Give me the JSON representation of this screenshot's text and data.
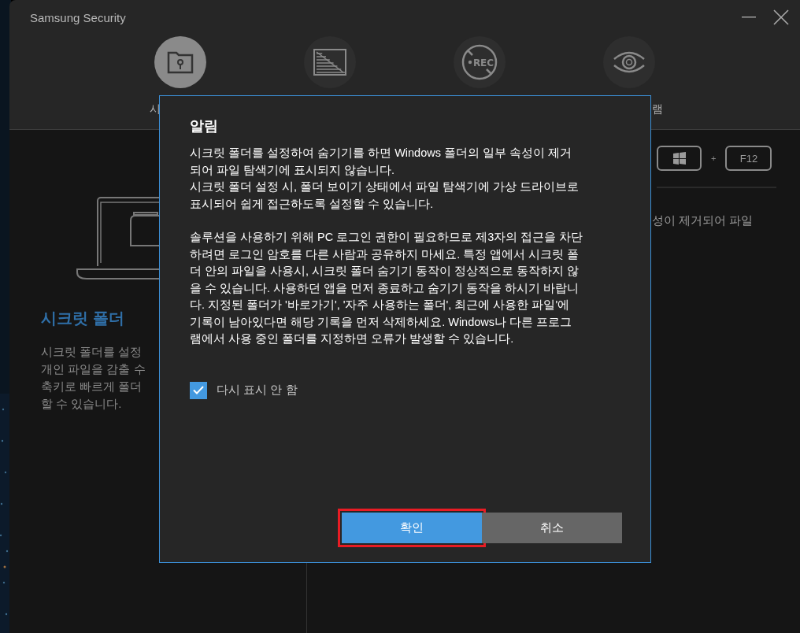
{
  "window": {
    "title": "Samsung Security"
  },
  "tabs": [
    {
      "label": "시",
      "selected": true
    },
    {
      "selected": false
    },
    {
      "selected": false,
      "icon_text": "REC"
    },
    {
      "label": "램",
      "selected": false
    }
  ],
  "left_panel": {
    "title": "시크릿 폴더",
    "description_lines": [
      "시크릿 폴더를 설정",
      "개인 파일을 감출 수",
      "축키로 빠르게 폴더",
      "할 수 있습니다."
    ]
  },
  "right_panel": {
    "keys": [
      {
        "kind": "windows"
      },
      {
        "kind": "text",
        "label": "F12"
      }
    ],
    "separator": "+",
    "text": "성이 제거되어 파일"
  },
  "dialog": {
    "title": "알림",
    "paragraphs": [
      {
        "lines": [
          "시크릿 폴더를 설정하여 숨기기를 하면 Windows 폴더의 일부 속성이 제거",
          "되어 파일 탐색기에 표시되지 않습니다.",
          "시크릿 폴더 설정 시, 폴더 보이기 상태에서 파일 탐색기에 가상 드라이브로",
          "표시되어 쉽게 접근하도록 설정할 수 있습니다."
        ]
      },
      {
        "lines": [
          "솔루션을 사용하기 위해 PC 로그인 권한이 필요하므로 제3자의 접근을 차단",
          "하려면 로그인 암호를 다른 사람과 공유하지 마세요. 특정 앱에서 시크릿 폴",
          "더 안의 파일을 사용시, 시크릿 폴더 숨기기 동작이 정상적으로 동작하지 않",
          "을 수 있습니다. 사용하던 앱을 먼저 종료하고 숨기기 동작을 하시기 바랍니",
          "다. 지정된 폴더가 '바로가기', '자주 사용하는 폴더', 최근에 사용한 파일'에",
          "기록이 남아있다면 해당 기록을 먼저 삭제하세요. Windows나 다른 프로그",
          "램에서 사용 중인 폴더를 지정하면 오류가 발생할 수 있습니다."
        ]
      }
    ],
    "checkbox": {
      "label": "다시 표시 안 함",
      "checked": true
    },
    "buttons": [
      {
        "label": "확인",
        "kind": "primary",
        "focused": true
      },
      {
        "label": "취소",
        "kind": "secondary",
        "focused": false
      }
    ]
  }
}
